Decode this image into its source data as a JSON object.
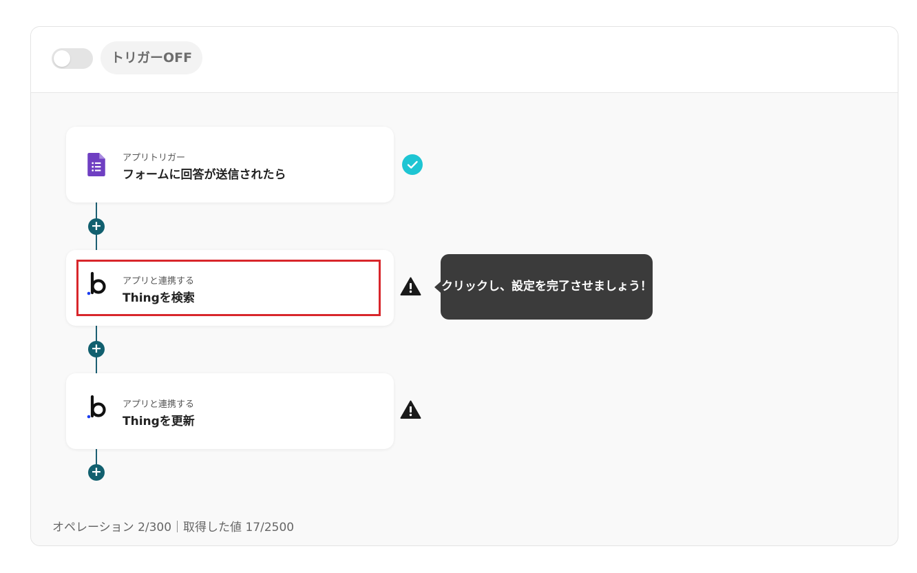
{
  "trigger": {
    "label": "トリガーOFF",
    "enabled": false
  },
  "steps": [
    {
      "subtitle": "アプリトリガー",
      "title": "フォームに回答が送信されたら",
      "icon": "google-forms-icon",
      "status": "completed"
    },
    {
      "subtitle": "アプリと連携する",
      "title": "Thingを検索",
      "icon": "bubble-icon",
      "status": "warning"
    },
    {
      "subtitle": "アプリと連携する",
      "title": "Thingを更新",
      "icon": "bubble-icon",
      "status": "warning"
    }
  ],
  "tooltip": {
    "text": "クリックし、設定を完了させましょう！"
  },
  "footer": {
    "text": "オペレーション 2/300｜取得した値 17/2500"
  },
  "colors": {
    "accent": "#12606f",
    "success": "#1ec5d3",
    "warning": "#1a1a1a",
    "highlight": "#d8262b",
    "forms": "#6f3fc2",
    "bubble_dot": "#1a3cf0"
  }
}
